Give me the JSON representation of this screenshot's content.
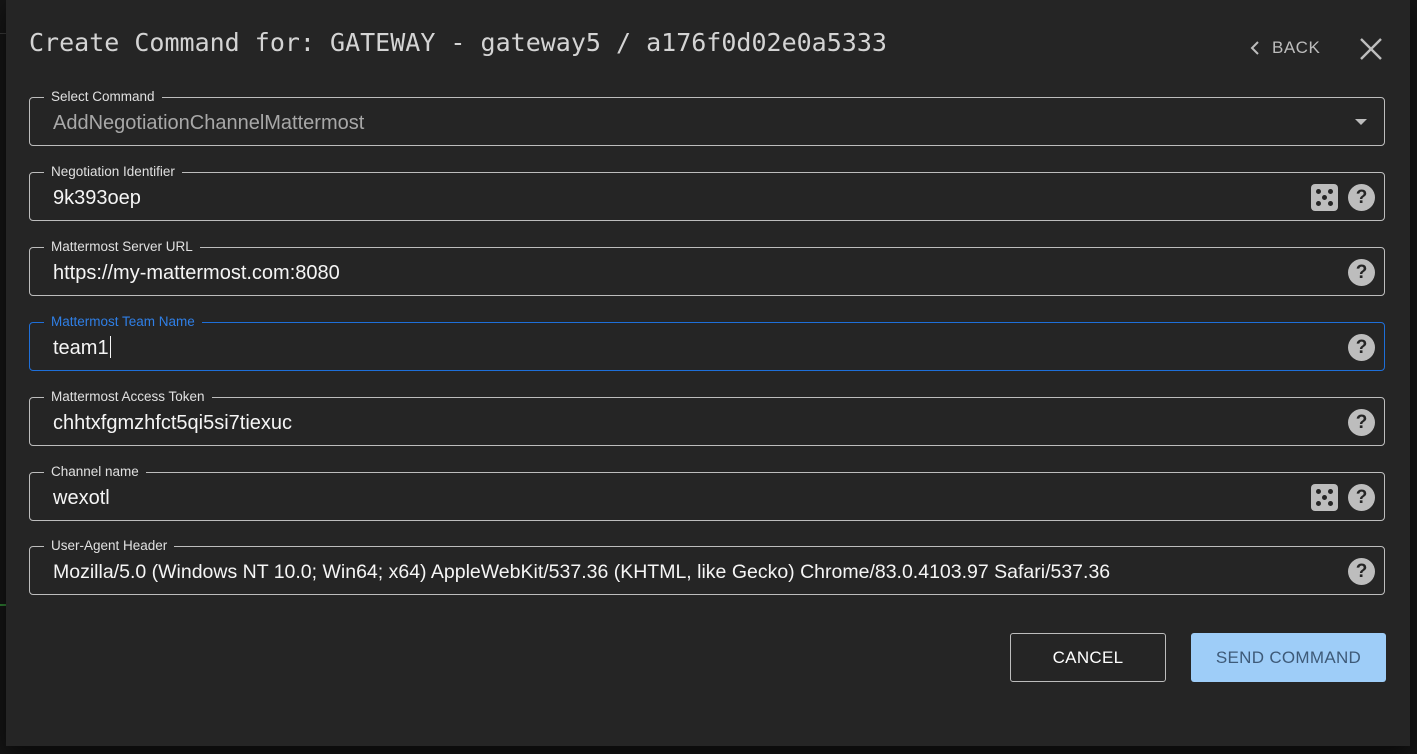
{
  "dialog": {
    "title": "Create Command for: GATEWAY - gateway5 / a176f0d02e0a5333",
    "back_label": "BACK"
  },
  "fields": [
    {
      "label": "Select Command",
      "value": "AddNegotiationChannelMattermost"
    },
    {
      "label": "Negotiation Identifier",
      "value": "9k393oep"
    },
    {
      "label": "Mattermost Server URL",
      "value": "https://my-mattermost.com:8080"
    },
    {
      "label": "Mattermost Team Name",
      "value": "team1"
    },
    {
      "label": "Mattermost Access Token",
      "value": "chhtxfgmzhfct5qi5si7tiexuc"
    },
    {
      "label": "Channel name",
      "value": "wexotl"
    },
    {
      "label": "User-Agent Header",
      "value": "Mozilla/5.0 (Windows NT 10.0; Win64; x64) AppleWebKit/537.36 (KHTML, like Gecko) Chrome/83.0.4103.97 Safari/537.36"
    }
  ],
  "help_glyph": "?",
  "buttons": {
    "cancel_label": "CANCEL",
    "send_label": "SEND COMMAND"
  },
  "colors": {
    "dialog_bg": "#252525",
    "focus_accent": "#2f7fe6",
    "send_button_bg": "#9ecdf8"
  }
}
